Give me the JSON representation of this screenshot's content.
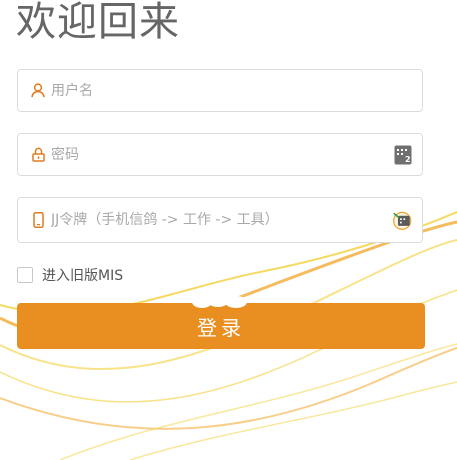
{
  "page": {
    "title": "欢迎回来"
  },
  "form": {
    "username": {
      "placeholder": "用户名",
      "value": "",
      "icon": "user-icon"
    },
    "password": {
      "placeholder": "密码",
      "value": "",
      "icon": "lock-icon",
      "action_icon": "keyboard-icon"
    },
    "token": {
      "placeholder": "JJ令牌（手机信鸽 -> 工作 -> 工具）",
      "value": "",
      "icon": "phone-icon",
      "action_icon": "token-app-icon"
    },
    "legacy": {
      "label": "进入旧版MIS",
      "checked": false
    },
    "submit_label": "登录"
  },
  "colors": {
    "accent": "#e98f22",
    "icon": "#e07b20",
    "title": "#666666",
    "border": "#dcdcdc",
    "placeholder": "#a8a8a8",
    "wave_yellow": "#f3cf3a",
    "wave_orange": "#f0a52a"
  }
}
